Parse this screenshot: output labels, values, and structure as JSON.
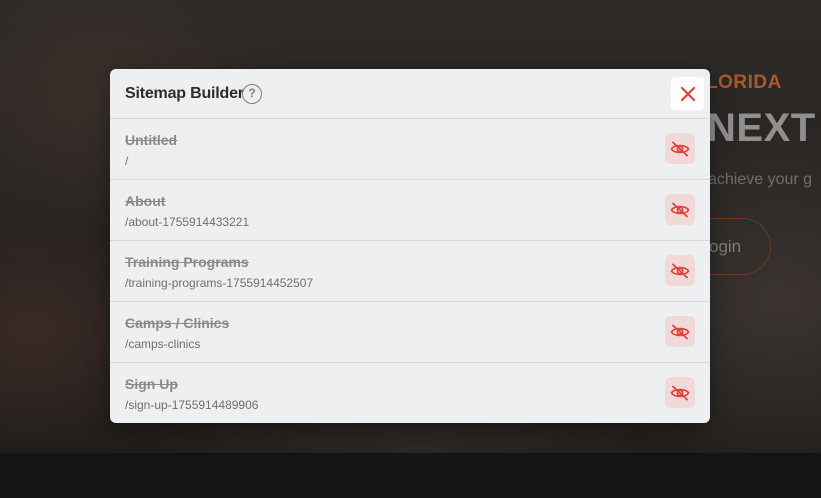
{
  "background": {
    "eyebrow": "LORIDA",
    "heading": "NEXT",
    "subtext": "achieve your g",
    "login_label": "ogin"
  },
  "modal": {
    "title": "Sitemap Builder",
    "help_icon": "question-circle-icon",
    "help_glyph": "?",
    "close_icon": "close-icon",
    "accent_color": "#e0433c",
    "pages": [
      {
        "title": "Untitled",
        "path": "/",
        "hidden": true,
        "icon": "eye-slash-icon"
      },
      {
        "title": "About",
        "path": "/about-1755914433221",
        "hidden": true,
        "icon": "eye-slash-icon"
      },
      {
        "title": "Training Programs",
        "path": "/training-programs-1755914452507",
        "hidden": true,
        "icon": "eye-slash-icon"
      },
      {
        "title": "Camps / Clinics",
        "path": "/camps-clinics",
        "hidden": true,
        "icon": "eye-slash-icon"
      },
      {
        "title": "Sign Up",
        "path": "/sign-up-1755914489906",
        "hidden": true,
        "icon": "eye-slash-icon"
      }
    ]
  }
}
